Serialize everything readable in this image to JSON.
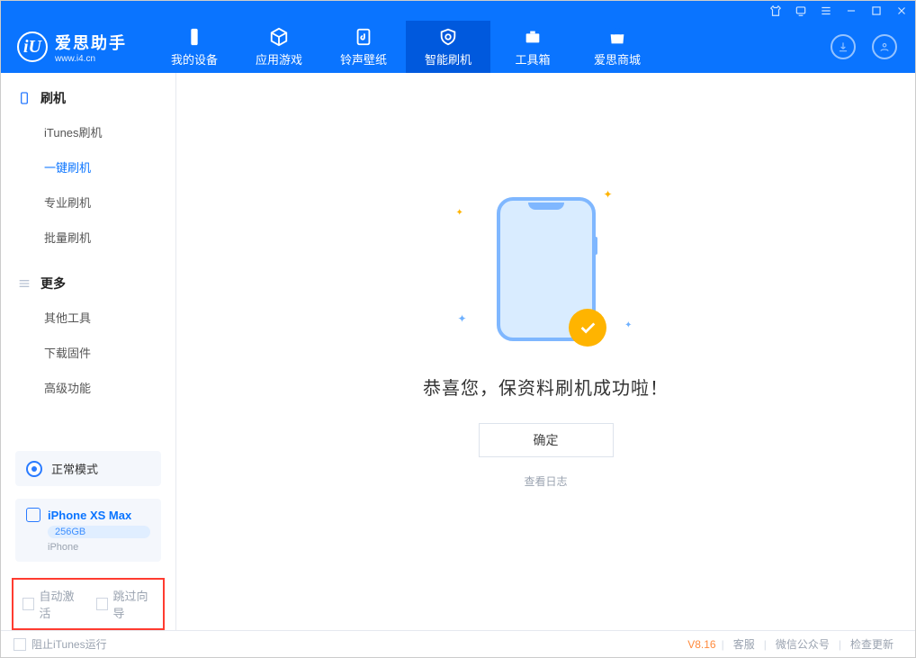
{
  "app": {
    "name": "爱思助手",
    "site": "www.i4.cn",
    "logo_letter": "iU"
  },
  "window_icons": [
    "shirt",
    "feedback",
    "menu",
    "min",
    "max",
    "close"
  ],
  "header": {
    "tabs": [
      {
        "id": "device",
        "label": "我的设备"
      },
      {
        "id": "apps",
        "label": "应用游戏"
      },
      {
        "id": "ring",
        "label": "铃声壁纸"
      },
      {
        "id": "flash",
        "label": "智能刷机",
        "active": true
      },
      {
        "id": "toolbox",
        "label": "工具箱"
      },
      {
        "id": "store",
        "label": "爱思商城"
      }
    ],
    "right": [
      "download",
      "account"
    ]
  },
  "sidebar": {
    "sections": [
      {
        "title": "刷机",
        "items": [
          {
            "id": "itunes",
            "label": "iTunes刷机"
          },
          {
            "id": "onekey",
            "label": "一键刷机",
            "active": true
          },
          {
            "id": "pro",
            "label": "专业刷机"
          },
          {
            "id": "batch",
            "label": "批量刷机"
          }
        ]
      },
      {
        "title": "更多",
        "items": [
          {
            "id": "othertools",
            "label": "其他工具"
          },
          {
            "id": "firmware",
            "label": "下载固件"
          },
          {
            "id": "advanced",
            "label": "高级功能"
          }
        ]
      }
    ],
    "mode": {
      "label": "正常模式"
    },
    "device": {
      "name": "iPhone XS Max",
      "storage": "256GB",
      "type": "iPhone"
    },
    "redbox": {
      "auto_activate": "自动激活",
      "skip_guide": "跳过向导"
    }
  },
  "main": {
    "success": "恭喜您，保资料刷机成功啦！",
    "ok": "确定",
    "view_log": "查看日志"
  },
  "footer": {
    "block_itunes": "阻止iTunes运行",
    "version": "V8.16",
    "links": [
      "客服",
      "微信公众号",
      "检查更新"
    ]
  }
}
